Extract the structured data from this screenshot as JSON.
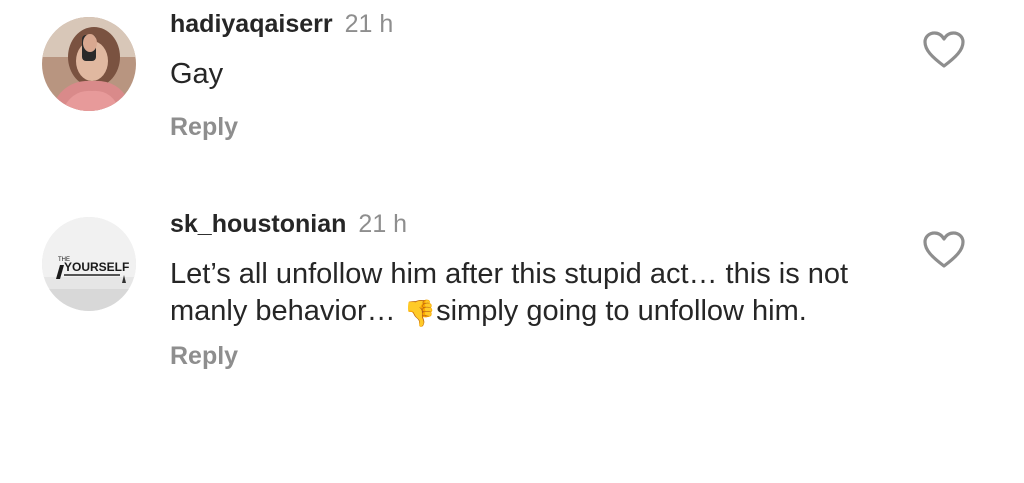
{
  "comments": [
    {
      "username": "hadiyaqaiserr",
      "time": "21 h",
      "text": "Gay",
      "reply_label": "Reply",
      "avatar_icon": "profile-photo-icon",
      "like_icon": "heart-outline-icon"
    },
    {
      "username": "sk_houstonian",
      "time": "21 h",
      "text_before_emoji": "Let’s all unfollow him after this stupid act… this is not manly behavior… ",
      "emoji": "👎",
      "text_after_emoji": "simply going to unfollow him.",
      "reply_label": "Reply",
      "avatar_text_small": "THE",
      "avatar_text": "YOURSELF",
      "like_icon": "heart-outline-icon"
    }
  ],
  "colors": {
    "text": "#262626",
    "secondary": "#8e8e8e",
    "emoji": "#f5b820"
  }
}
